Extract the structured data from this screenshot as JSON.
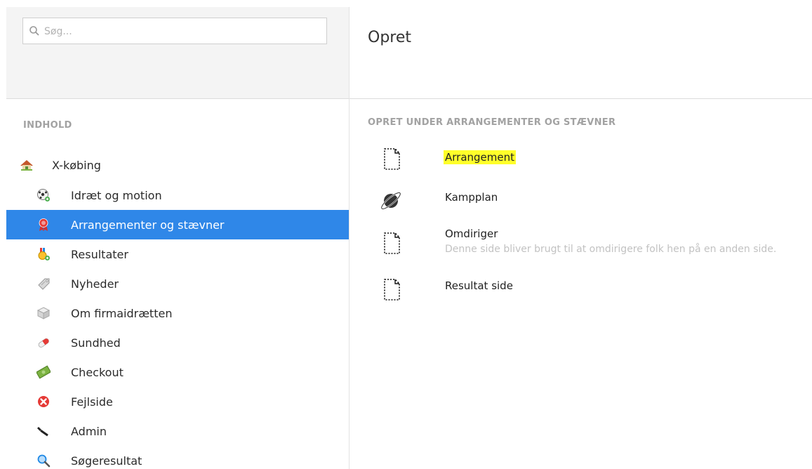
{
  "search": {
    "placeholder": "Søg..."
  },
  "tree": {
    "section_title": "INDHOLD",
    "root": {
      "label": "X-købing",
      "icon": "home-icon"
    },
    "children": [
      {
        "label": "Idræt og motion",
        "icon": "soccer-ball-icon"
      },
      {
        "label": "Arrangementer og stævner",
        "icon": "award-ribbon-icon",
        "selected": true
      },
      {
        "label": "Resultater",
        "icon": "medal-icon"
      },
      {
        "label": "Nyheder",
        "icon": "tag-icon"
      },
      {
        "label": "Om firmaidrætten",
        "icon": "cube-icon"
      },
      {
        "label": "Sundhed",
        "icon": "pill-icon"
      },
      {
        "label": "Checkout",
        "icon": "money-icon"
      },
      {
        "label": "Fejlside",
        "icon": "error-icon"
      },
      {
        "label": "Admin",
        "icon": "wrench-icon"
      },
      {
        "label": "Søgeresultat",
        "icon": "magnifier-icon"
      }
    ]
  },
  "panel": {
    "title": "Opret",
    "heading": "OPRET UNDER ARRANGEMENTER OG STÆVNER",
    "types": [
      {
        "name": "Arrangement",
        "description": "",
        "icon": "document-icon",
        "highlighted": true
      },
      {
        "name": "Kampplan",
        "description": "",
        "icon": "planet-icon"
      },
      {
        "name": "Omdiriger",
        "description": "Denne side bliver brugt til at omdirigere folk hen på en anden side.",
        "icon": "document-icon"
      },
      {
        "name": "Resultat side",
        "description": "",
        "icon": "document-icon"
      }
    ]
  },
  "colors": {
    "selected": "#2f87e8",
    "highlight": "#ffff2a"
  }
}
